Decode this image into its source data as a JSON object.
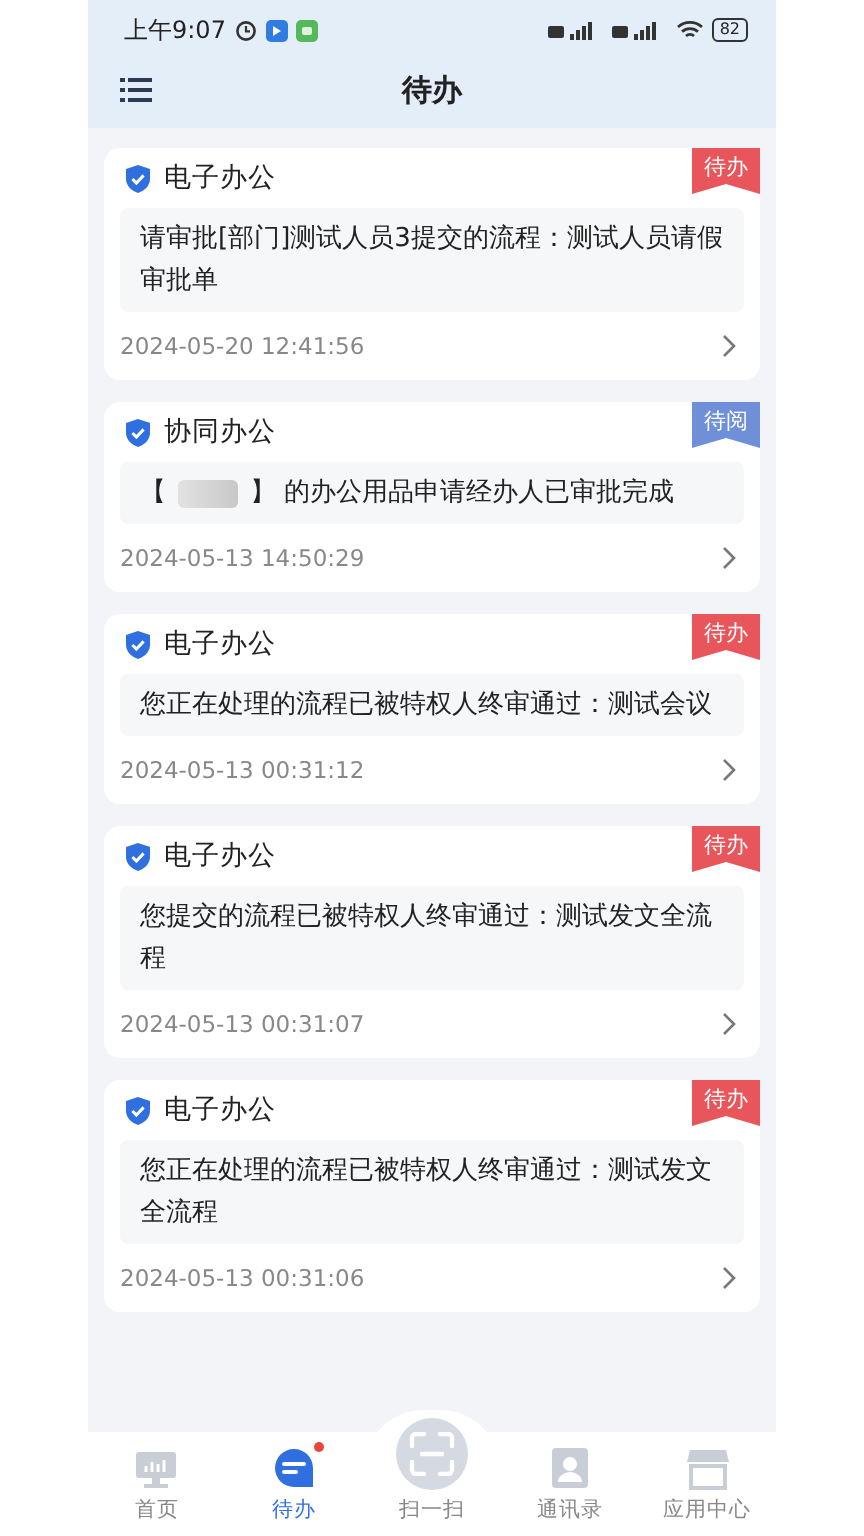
{
  "status_bar": {
    "time": "上午9:07",
    "battery": "82"
  },
  "header": {
    "title": "待办"
  },
  "items": [
    {
      "source": "电子办公",
      "tag": {
        "text": "待办",
        "color": "#e8555a"
      },
      "kind": "text",
      "message": "请审批[部门]测试人员3提交的流程：测试人员请假审批单",
      "date": "2024-05-20 12:41:56"
    },
    {
      "source": "协同办公",
      "tag": {
        "text": "待阅",
        "color": "#6f8fd8"
      },
      "kind": "redacted",
      "message_before": "【",
      "message_after": "】 的办公用品申请经办人已审批完成",
      "date": "2024-05-13 14:50:29"
    },
    {
      "source": "电子办公",
      "tag": {
        "text": "待办",
        "color": "#e8555a"
      },
      "kind": "text",
      "message": "您正在处理的流程已被特权人终审通过：测试会议",
      "date": "2024-05-13 00:31:12"
    },
    {
      "source": "电子办公",
      "tag": {
        "text": "待办",
        "color": "#e8555a"
      },
      "kind": "text",
      "message": "您提交的流程已被特权人终审通过：测试发文全流程",
      "date": "2024-05-13 00:31:07"
    },
    {
      "source": "电子办公",
      "tag": {
        "text": "待办",
        "color": "#e8555a"
      },
      "kind": "text",
      "message": "您正在处理的流程已被特权人终审通过：测试发文全流程",
      "date": "2024-05-13 00:31:06"
    }
  ],
  "nav": [
    {
      "label": "首页",
      "kind": "home",
      "selected": false,
      "badge": false
    },
    {
      "label": "待办",
      "kind": "todo",
      "selected": true,
      "badge": true
    },
    {
      "label": "扫一扫",
      "kind": "scan",
      "selected": false,
      "badge": false
    },
    {
      "label": "通讯录",
      "kind": "contacts",
      "selected": false,
      "badge": false
    },
    {
      "label": "应用中心",
      "kind": "apps",
      "selected": false,
      "badge": false
    }
  ]
}
